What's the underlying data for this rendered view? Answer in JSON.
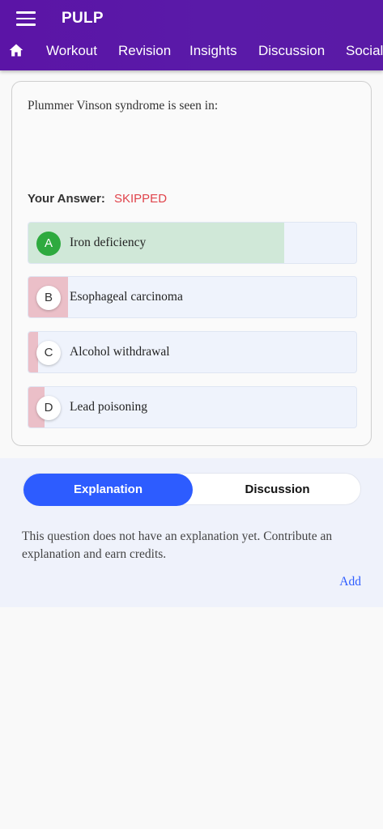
{
  "app": {
    "title": "PULP"
  },
  "nav": {
    "tabs": [
      "Workout",
      "Revision",
      "Insights",
      "Discussion",
      "Social"
    ]
  },
  "question": {
    "text": "Plummer Vinson syndrome is seen in:",
    "your_answer_label": "Your Answer:",
    "answer_status": "SKIPPED",
    "options": [
      {
        "letter": "A",
        "label": "Iron deficiency",
        "correct": true,
        "response_fraction": 0.78
      },
      {
        "letter": "B",
        "label": "Esophageal carcinoma",
        "correct": false,
        "response_fraction": 0.12
      },
      {
        "letter": "C",
        "label": "Alcohol withdrawal",
        "correct": false,
        "response_fraction": 0.03
      },
      {
        "letter": "D",
        "label": "Lead poisoning",
        "correct": false,
        "response_fraction": 0.05
      }
    ]
  },
  "explanation": {
    "tabs": {
      "active": "Explanation",
      "inactive": "Discussion"
    },
    "text": "This question does not have an explanation yet. Contribute an explanation and earn credits.",
    "add_label": "Add"
  },
  "colors": {
    "appbar": "#5a1aa8",
    "correct_fill": "#d0e8d8",
    "wrong_fill": "#ebbfc8",
    "correct_badge": "#2eaa3f",
    "skipped": "#e0434b",
    "accent": "#2d5cff"
  },
  "icons": {
    "menu": "hamburger-icon",
    "home": "home-icon"
  }
}
